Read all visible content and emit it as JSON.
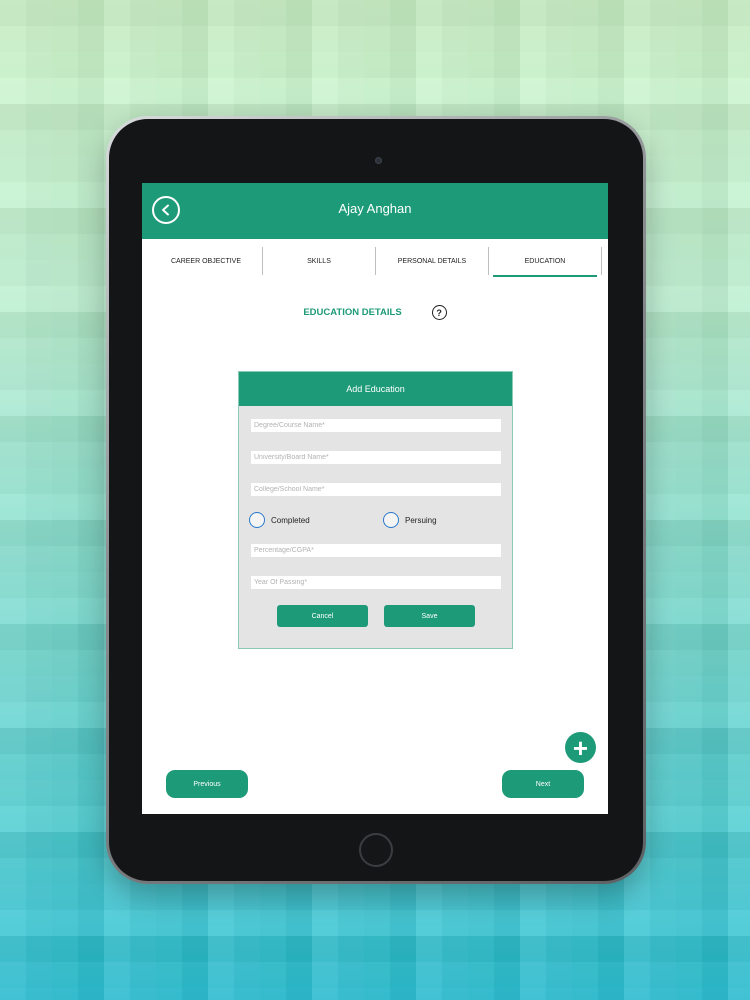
{
  "app": {
    "title": "Ajay Anghan",
    "back_icon": "back-arrow-icon"
  },
  "tabs": [
    {
      "label": "CAREER OBJECTIVE",
      "active": false
    },
    {
      "label": "SKILLS",
      "active": false
    },
    {
      "label": "PERSONAL DETAILS",
      "active": false
    },
    {
      "label": "EDUCATION",
      "active": true
    }
  ],
  "section": {
    "title": "EDUCATION DETAILS",
    "help_icon": "question-icon",
    "help_symbol": "?"
  },
  "dialog": {
    "title": "Add Education",
    "fields": {
      "degree_placeholder": "Degree/Course Name*",
      "university_placeholder": "University/Board Name*",
      "college_placeholder": "College/School Name*",
      "percentage_placeholder": "Percentage/CGPA*",
      "year_placeholder": "Year Of Passing*"
    },
    "status_options": [
      "Completed",
      "Persuing"
    ],
    "cancel_label": "Cancel",
    "save_label": "Save"
  },
  "fab": {
    "icon": "plus-icon",
    "symbol": "+"
  },
  "footer": {
    "previous_label": "Previous",
    "next_label": "Next"
  },
  "colors": {
    "accent": "#1d9a78",
    "radio": "#2b79c9"
  }
}
